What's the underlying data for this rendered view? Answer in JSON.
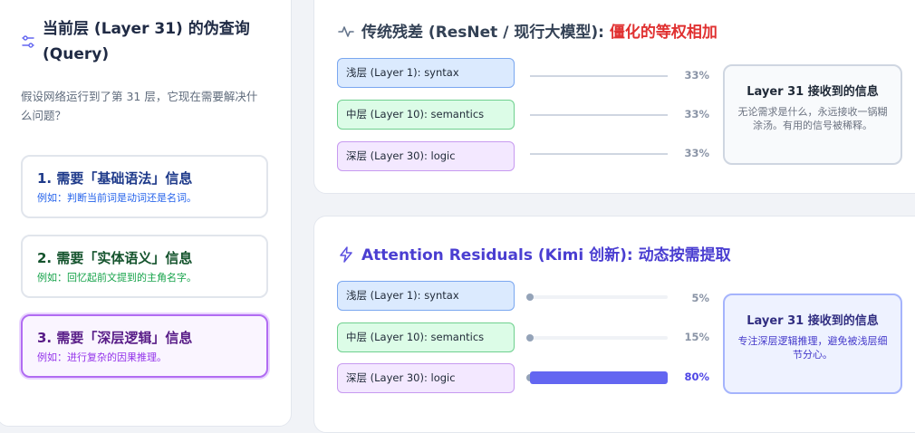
{
  "query_panel": {
    "title": "当前层 (Layer 31) 的伪查询 (Query)",
    "description": "假设网络运行到了第 31 层，它现在需要解决什么问题？",
    "needs": [
      {
        "title": "1. 需要「基础语法」信息",
        "example": "例如：判断当前词是动词还是名词。"
      },
      {
        "title": "2. 需要「实体语义」信息",
        "example": "例如：回忆起前文提到的主角名字。"
      },
      {
        "title": "3. 需要「深层逻辑」信息",
        "example": "例如：进行复杂的因果推理。"
      }
    ]
  },
  "traditional": {
    "title": "传统残差 (ResNet / 现行大模型): ",
    "title_accent": "僵化的等权相加",
    "layers": [
      {
        "label": "浅层 (Layer 1): syntax",
        "percent": "33%",
        "weight": 0.33
      },
      {
        "label": "中层 (Layer 10): semantics",
        "percent": "33%",
        "weight": 0.33
      },
      {
        "label": "深层 (Layer 30): logic",
        "percent": "33%",
        "weight": 0.33
      }
    ],
    "receive": {
      "title": "Layer 31 接收到的信息",
      "desc": "无论需求是什么，永远接收一锅糊涂汤。有用的信号被稀释。"
    }
  },
  "attention": {
    "title": "Attention Residuals (Kimi 创新): 动态按需提取",
    "layers": [
      {
        "label": "浅层 (Layer 1): syntax",
        "percent": "5%",
        "weight": 0.05
      },
      {
        "label": "中层 (Layer 10): semantics",
        "percent": "15%",
        "weight": 0.15
      },
      {
        "label": "深层 (Layer 30): logic",
        "percent": "80%",
        "weight": 0.8
      }
    ],
    "receive": {
      "title": "Layer 31 接收到的信息",
      "desc": "专注深层逻辑推理，避免被浅层细节分心。"
    }
  },
  "colors": {
    "accent_red": "#e03131",
    "accent_indigo": "#4a3ed1",
    "bar_fill": "#6366f1"
  },
  "icons": {
    "query": "sliders-icon",
    "traditional": "activity-pulse-icon",
    "attention": "lightning-bolt-icon"
  }
}
